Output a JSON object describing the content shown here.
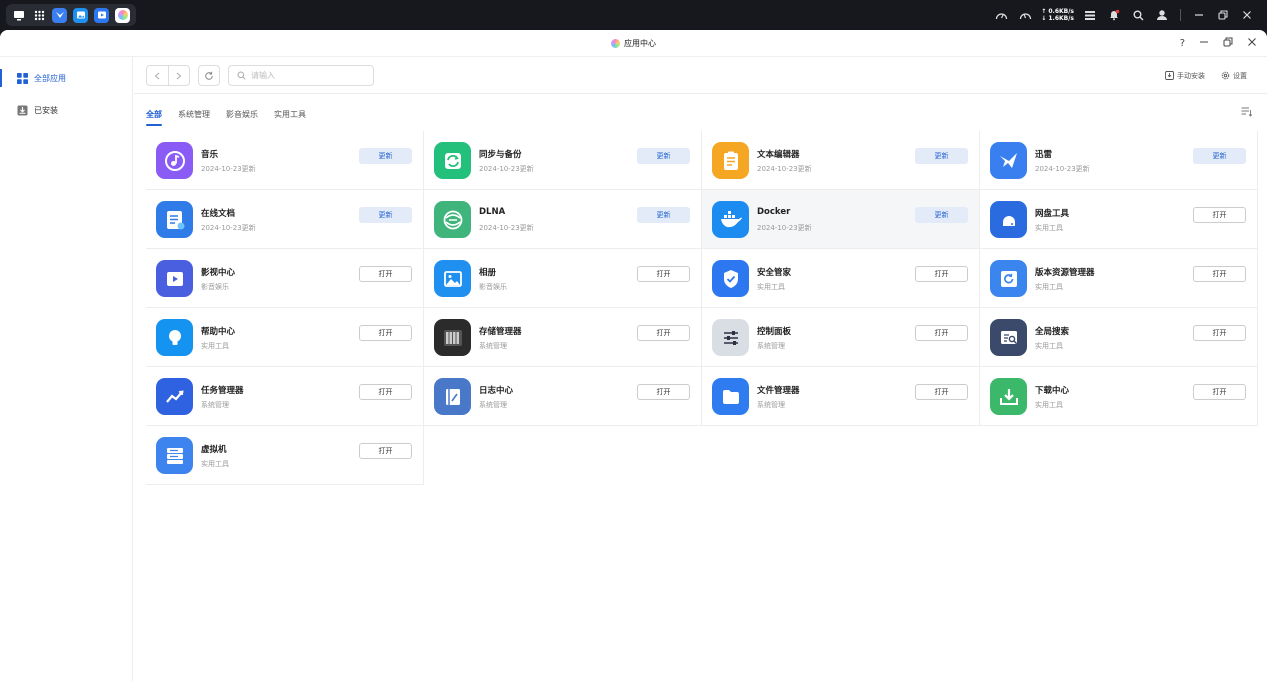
{
  "taskbar": {
    "net_up": "↑ 0.6KB/s",
    "net_down": "↓ 1.6KB/s",
    "pinned_apps": [
      "client",
      "photos",
      "video-center",
      "app-center"
    ]
  },
  "window": {
    "title": "应用中心",
    "help_label": "?",
    "controls": [
      "minimize",
      "restore",
      "close"
    ]
  },
  "sidebar": {
    "items": [
      {
        "label": "全部应用",
        "icon": "grid-icon",
        "active": true
      },
      {
        "label": "已安装",
        "icon": "download-icon",
        "active": false
      }
    ]
  },
  "toolbar": {
    "search_placeholder": "请输入",
    "manual_install_label": "手动安装",
    "settings_label": "设置"
  },
  "tabs": [
    "全部",
    "系统管理",
    "影音娱乐",
    "实用工具"
  ],
  "actions": {
    "update": "更新",
    "open": "打开"
  },
  "apps": [
    {
      "name": "音乐",
      "sub": "2024-10-23更新",
      "action": "更新",
      "icon": "music-icon",
      "color": "#8a5cf5"
    },
    {
      "name": "同步与备份",
      "sub": "2024-10-23更新",
      "action": "更新",
      "icon": "sync-icon",
      "color": "#22c07a"
    },
    {
      "name": "文本编辑器",
      "sub": "2024-10-23更新",
      "action": "更新",
      "icon": "notepad-icon",
      "color": "#f5a623"
    },
    {
      "name": "迅雷",
      "sub": "2024-10-23更新",
      "action": "更新",
      "icon": "bird-icon",
      "color": "#3a7ff0"
    },
    {
      "name": "在线文档",
      "sub": "2024-10-23更新",
      "action": "更新",
      "icon": "document-icon",
      "color": "#2f7ce8"
    },
    {
      "name": "DLNA",
      "sub": "2024-10-23更新",
      "action": "更新",
      "icon": "dlna-icon",
      "color": "#3fb57c"
    },
    {
      "name": "Docker",
      "sub": "2024-10-23更新",
      "action": "更新",
      "icon": "whale-icon",
      "color": "#1d8cf0"
    },
    {
      "name": "网盘工具",
      "sub": "实用工具",
      "action": "打开",
      "icon": "cloud-drive-icon",
      "color": "#2a6be0"
    },
    {
      "name": "影视中心",
      "sub": "影音娱乐",
      "action": "打开",
      "icon": "film-icon",
      "color": "#4a5fe0"
    },
    {
      "name": "相册",
      "sub": "影音娱乐",
      "action": "打开",
      "icon": "image-icon",
      "color": "#1f8ff0"
    },
    {
      "name": "安全管家",
      "sub": "实用工具",
      "action": "打开",
      "icon": "shield-icon",
      "color": "#2d78f0"
    },
    {
      "name": "版本资源管理器",
      "sub": "实用工具",
      "action": "打开",
      "icon": "history-icon",
      "color": "#3a86ee"
    },
    {
      "name": "帮助中心",
      "sub": "实用工具",
      "action": "打开",
      "icon": "bulb-icon",
      "color": "#1593f0"
    },
    {
      "name": "存储管理器",
      "sub": "系统管理",
      "action": "打开",
      "icon": "storage-icon",
      "color": "#2b2b2b"
    },
    {
      "name": "控制面板",
      "sub": "系统管理",
      "action": "打开",
      "icon": "sliders-icon",
      "color": "#d9dde4"
    },
    {
      "name": "全局搜索",
      "sub": "实用工具",
      "action": "打开",
      "icon": "search-doc-icon",
      "color": "#3b4a6b"
    },
    {
      "name": "任务管理器",
      "sub": "系统管理",
      "action": "打开",
      "icon": "chart-icon",
      "color": "#2f62e0"
    },
    {
      "name": "日志中心",
      "sub": "系统管理",
      "action": "打开",
      "icon": "log-icon",
      "color": "#4a78c8"
    },
    {
      "name": "文件管理器",
      "sub": "系统管理",
      "action": "打开",
      "icon": "folder-icon",
      "color": "#2f7cf0"
    },
    {
      "name": "下载中心",
      "sub": "实用工具",
      "action": "打开",
      "icon": "download-tray-icon",
      "color": "#3cb86a"
    },
    {
      "name": "虚拟机",
      "sub": "实用工具",
      "action": "打开",
      "icon": "server-icon",
      "color": "#3d84ee"
    }
  ]
}
